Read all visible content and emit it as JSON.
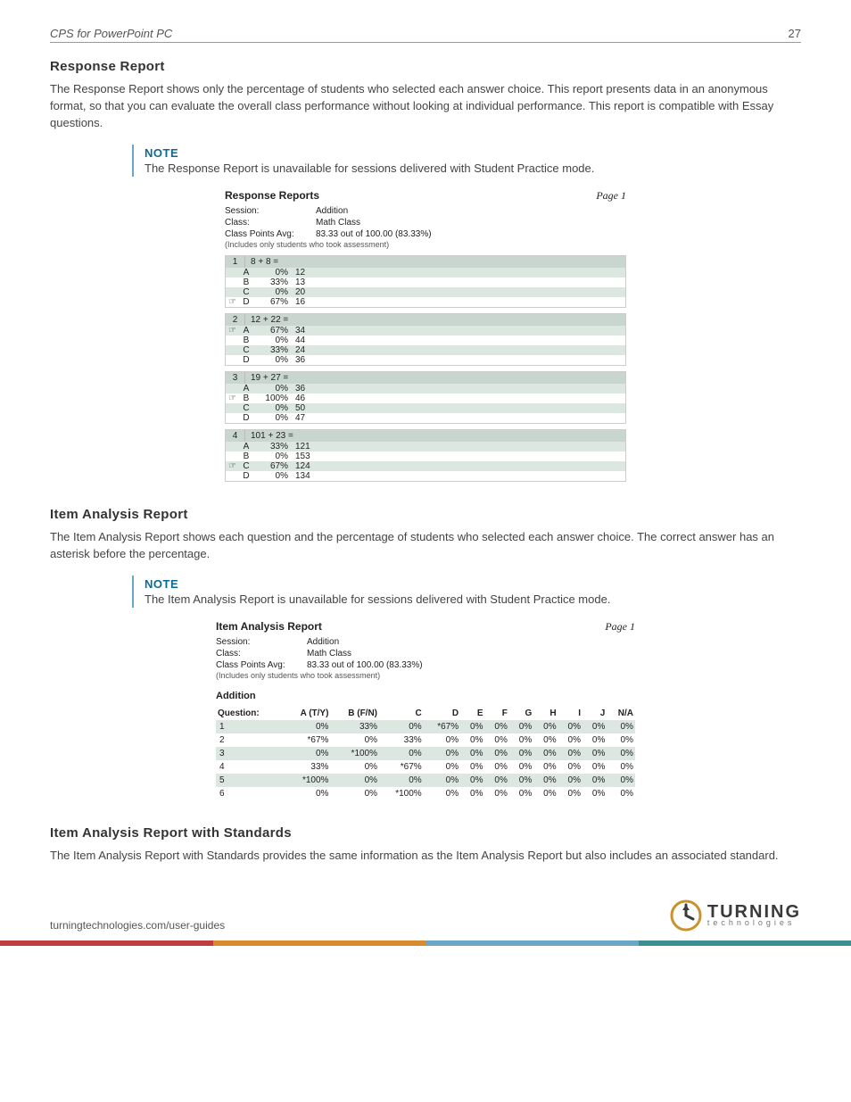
{
  "header": {
    "title": "CPS for PowerPoint PC",
    "page": "27"
  },
  "s1": {
    "h": "Response Report",
    "p": "The Response Report shows only the percentage of students who selected each answer choice. This report presents data in an anonymous format, so that you can evaluate the overall class performance without looking at individual performance.  This report is compatible with Essay questions.",
    "noteLabel": "NOTE",
    "note": "The Response Report is unavailable for sessions delivered with Student Practice mode."
  },
  "fig1": {
    "title": "Response Reports",
    "page": "Page 1",
    "sessionLabel": "Session:",
    "session": "Addition",
    "classLabel": "Class:",
    "class": "Math Class",
    "avgLabel": "Class Points Avg:",
    "avg": "83.33 out of 100.00 (83.33%)",
    "sub": "(Includes only students who took assessment)",
    "questions": [
      {
        "n": "1",
        "t": "8 + 8 =",
        "opts": [
          {
            "s": "",
            "l": "A",
            "p": "0%",
            "v": "12"
          },
          {
            "s": "",
            "l": "B",
            "p": "33%",
            "v": "13"
          },
          {
            "s": "",
            "l": "C",
            "p": "0%",
            "v": "20"
          },
          {
            "s": "☞",
            "l": "D",
            "p": "67%",
            "v": "16"
          }
        ]
      },
      {
        "n": "2",
        "t": "12 + 22 =",
        "opts": [
          {
            "s": "☞",
            "l": "A",
            "p": "67%",
            "v": "34"
          },
          {
            "s": "",
            "l": "B",
            "p": "0%",
            "v": "44"
          },
          {
            "s": "",
            "l": "C",
            "p": "33%",
            "v": "24"
          },
          {
            "s": "",
            "l": "D",
            "p": "0%",
            "v": "36"
          }
        ]
      },
      {
        "n": "3",
        "t": "19 + 27 =",
        "opts": [
          {
            "s": "",
            "l": "A",
            "p": "0%",
            "v": "36"
          },
          {
            "s": "☞",
            "l": "B",
            "p": "100%",
            "v": "46"
          },
          {
            "s": "",
            "l": "C",
            "p": "0%",
            "v": "50"
          },
          {
            "s": "",
            "l": "D",
            "p": "0%",
            "v": "47"
          }
        ]
      },
      {
        "n": "4",
        "t": "101 + 23 =",
        "opts": [
          {
            "s": "",
            "l": "A",
            "p": "33%",
            "v": "121"
          },
          {
            "s": "",
            "l": "B",
            "p": "0%",
            "v": "153"
          },
          {
            "s": "☞",
            "l": "C",
            "p": "67%",
            "v": "124"
          },
          {
            "s": "",
            "l": "D",
            "p": "0%",
            "v": "134"
          }
        ]
      }
    ]
  },
  "s2": {
    "h": "Item Analysis Report",
    "p": "The Item Analysis Report shows each question and the percentage of students who selected each answer choice. The correct answer has an asterisk before the percentage.",
    "noteLabel": "NOTE",
    "note": "The Item Analysis Report is unavailable for sessions delivered with Student Practice mode."
  },
  "fig2": {
    "title": "Item Analysis Report",
    "page": "Page 1",
    "sessionLabel": "Session:",
    "session": "Addition",
    "classLabel": "Class:",
    "class": "Math Class",
    "avgLabel": "Class Points Avg:",
    "avg": "83.33 out of 100.00 (83.33%)",
    "sub": "(Includes only students who took assessment)",
    "sectionLabel": "Addition",
    "cols": [
      "Question:",
      "A (T/Y)",
      "B (F/N)",
      "C",
      "D",
      "E",
      "F",
      "G",
      "H",
      "I",
      "J",
      "N/A"
    ],
    "rows": [
      [
        "1",
        "0%",
        "33%",
        "0%",
        "*67%",
        "0%",
        "0%",
        "0%",
        "0%",
        "0%",
        "0%",
        "0%"
      ],
      [
        "2",
        "*67%",
        "0%",
        "33%",
        "0%",
        "0%",
        "0%",
        "0%",
        "0%",
        "0%",
        "0%",
        "0%"
      ],
      [
        "3",
        "0%",
        "*100%",
        "0%",
        "0%",
        "0%",
        "0%",
        "0%",
        "0%",
        "0%",
        "0%",
        "0%"
      ],
      [
        "4",
        "33%",
        "0%",
        "*67%",
        "0%",
        "0%",
        "0%",
        "0%",
        "0%",
        "0%",
        "0%",
        "0%"
      ],
      [
        "5",
        "*100%",
        "0%",
        "0%",
        "0%",
        "0%",
        "0%",
        "0%",
        "0%",
        "0%",
        "0%",
        "0%"
      ],
      [
        "6",
        "0%",
        "0%",
        "*100%",
        "0%",
        "0%",
        "0%",
        "0%",
        "0%",
        "0%",
        "0%",
        "0%"
      ]
    ]
  },
  "s3": {
    "h": "Item Analysis Report with Standards",
    "p": "The Item Analysis Report with Standards provides the same information as the Item Analysis Report but also includes an associated standard."
  },
  "footer": {
    "url": "turningtechnologies.com/user-guides",
    "logoBig": "TURNING",
    "logoSmall": "technologies"
  }
}
